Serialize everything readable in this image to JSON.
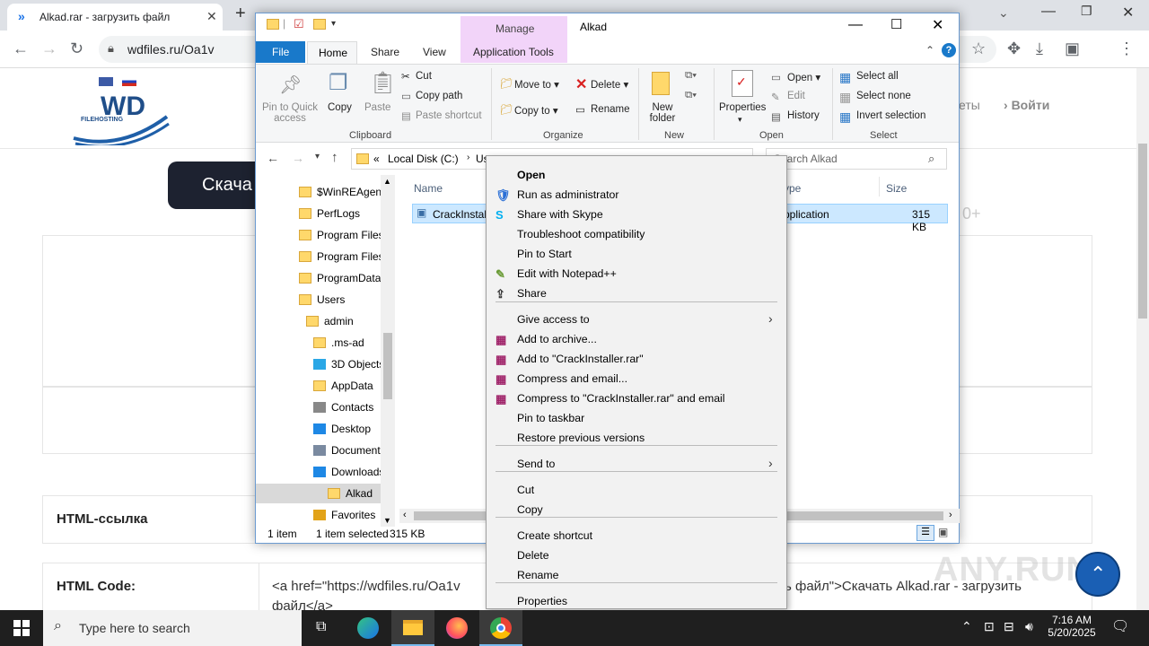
{
  "browser": {
    "tab_title": "Alkad.rar - загрузить файл",
    "url": "wdfiles.ru/Oa1v",
    "new_tab": "+"
  },
  "site": {
    "logo_text": "WD",
    "logo_sub": "FILEHOSTING",
    "nav_partial": "еты",
    "login": "Войти",
    "download_button": "Скача",
    "html_link_label": "HTML-ссылка",
    "html_code_label": "HTML Code:",
    "html_code_value_1": "<a href=\"https://wdfiles.ru/Oa1v",
    "html_code_value_2": "ь файл\">Скачать Alkad.rar - загрузить",
    "html_code_value_3": "файл</a>",
    "side_partial": "0+"
  },
  "explorer": {
    "title": "Alkad",
    "manage_tab": "Manage",
    "tabs": [
      "File",
      "Home",
      "Share",
      "View",
      "Application Tools"
    ],
    "clipboard": {
      "pin": "Pin to Quick access",
      "copy": "Copy",
      "paste": "Paste",
      "cut": "Cut",
      "copy_path": "Copy path",
      "paste_shortcut": "Paste shortcut",
      "label": "Clipboard"
    },
    "organize": {
      "move_to": "Move to",
      "copy_to": "Copy to",
      "delete": "Delete",
      "rename": "Rename",
      "label": "Organize"
    },
    "new": {
      "new_folder": "New folder",
      "label": "New"
    },
    "open": {
      "properties": "Properties",
      "open": "Open",
      "edit": "Edit",
      "history": "History",
      "label": "Open"
    },
    "select": {
      "select_all": "Select all",
      "select_none": "Select none",
      "invert": "Invert selection",
      "label": "Select"
    },
    "address": {
      "prefix": "«",
      "path1": "Local Disk (C:)",
      "path2": "Us",
      "search_placeholder": "Search Alkad"
    },
    "columns": {
      "name": "Name",
      "type": "ype",
      "size": "Size"
    },
    "file": {
      "name": "CrackInstal",
      "type": "pplication",
      "size": "315 KB"
    },
    "tree": [
      "$WinREAgent",
      "PerfLogs",
      "Program Files",
      "Program Files",
      "ProgramData",
      "Users",
      "admin",
      ".ms-ad",
      "3D Objects",
      "AppData",
      "Contacts",
      "Desktop",
      "Documents",
      "Downloads",
      "Alkad",
      "Favorites"
    ],
    "status": {
      "items": "1 item",
      "selected": "1 item selected",
      "size": "315 KB"
    }
  },
  "context_menu": {
    "items": [
      "Open",
      "Run as administrator",
      "Share with Skype",
      "Troubleshoot compatibility",
      "Pin to Start",
      "Edit with Notepad++",
      "Share",
      "Give access to",
      "Add to archive...",
      "Add to \"CrackInstaller.rar\"",
      "Compress and email...",
      "Compress to \"CrackInstaller.rar\" and email",
      "Pin to taskbar",
      "Restore previous versions",
      "Send to",
      "Cut",
      "Copy",
      "Create shortcut",
      "Delete",
      "Rename",
      "Properties"
    ]
  },
  "taskbar": {
    "search_placeholder": "Type here to search",
    "time": "7:16 AM",
    "date": "5/20/2025"
  },
  "watermark": "ANY.RUN"
}
